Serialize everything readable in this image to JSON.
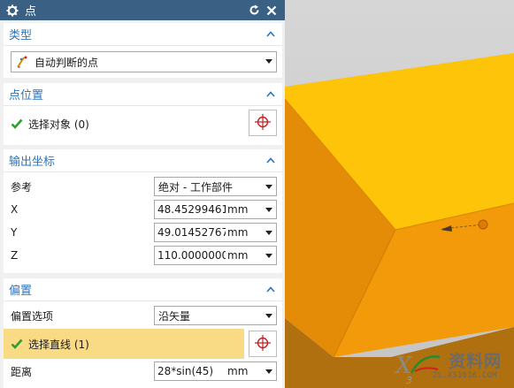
{
  "dialog": {
    "title": "点",
    "icons": {
      "settings": "gear-icon",
      "reset": "reset-icon",
      "close": "close-icon"
    }
  },
  "type_section": {
    "title": "类型",
    "select_value": "自动判断的点",
    "icon": "inferred-point-icon"
  },
  "point_location": {
    "title": "点位置",
    "select_object_label": "选择对象 (0)",
    "icon": "point-dialog-crosshair-icon"
  },
  "output_coords": {
    "title": "输出坐标",
    "reference_label": "参考",
    "reference_value": "绝对 - 工作部件",
    "x_label": "X",
    "x_value": "48.45299461",
    "x_unit": "mm",
    "y_label": "Y",
    "y_value": "49.01452767",
    "y_unit": "mm",
    "z_label": "Z",
    "z_value": "110.00000000",
    "z_unit": "mm"
  },
  "offset": {
    "title": "偏置",
    "option_label": "偏置选项",
    "option_value": "沿矢量",
    "select_line_label": "选择直线 (1)",
    "distance_label": "距离",
    "distance_value": "28*sin(45)",
    "distance_unit": "mm"
  },
  "watermark": {
    "title": "资料网",
    "url": "ZL.XS1616.COM"
  },
  "colors": {
    "titlebar": "#3a6184",
    "section_title": "#2b74bd",
    "highlight": "#fadb85",
    "check_green": "#2e9e2e",
    "model_top": "#fdc40a",
    "model_front": "#f39a0a",
    "model_side": "#e48c08",
    "viewport_bg": "#c9c9c9"
  }
}
